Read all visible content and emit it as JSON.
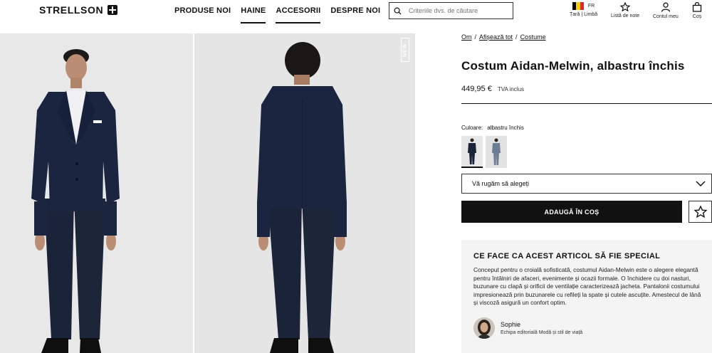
{
  "header": {
    "logo_text": "STRELLSON",
    "nav": [
      {
        "label": "PRODUSE NOI"
      },
      {
        "label": "HAINE"
      },
      {
        "label": "ACCESORII"
      },
      {
        "label": "DESPRE NOI"
      }
    ],
    "search": {
      "placeholder": "Criteriile dvs. de căutare"
    },
    "utilities": {
      "country": {
        "lang": "FR",
        "label": "Țară | Limbă"
      },
      "wishlist": {
        "label": "Listă de note"
      },
      "account": {
        "label": "Contul meu"
      },
      "cart": {
        "label": "Coș"
      }
    }
  },
  "gallery": {
    "badge": "NEW"
  },
  "product": {
    "breadcrumb": [
      "Om",
      "Afișează tot",
      "Costume"
    ],
    "title": "Costum Aidan-Melwin, albastru închis",
    "price": "449,95 €",
    "vat": "TVA inclus",
    "color_label": "Culoare:",
    "color_value": "albastru închis",
    "size_select": "Vă rugăm să alegeți",
    "add_to_cart": "ADAUGĂ ÎN COȘ"
  },
  "special": {
    "heading": "CE FACE CA ACEST ARTICOL SĂ FIE SPECIAL",
    "text": "Conceput pentru o croială sofisticată, costumul Aidan-Melwin este o alegere elegantă pentru întâlniri de afaceri, evenimente și ocazii formale. O închidere cu doi nasturi, buzunare cu clapă și orificii de ventilație caracterizează jacheta. Pantalonii costumului impresionează prin buzunarele cu refileți la spate și cutele ascuțite. Amestecul de lână și viscoză asigură un confort optim.",
    "author_name": "Sophie",
    "author_role": "Echipa editorială Modă și stil de viață"
  },
  "colors": {
    "navy": "#1b2338",
    "accent": "#111111",
    "panel": "#f4f4f4"
  }
}
